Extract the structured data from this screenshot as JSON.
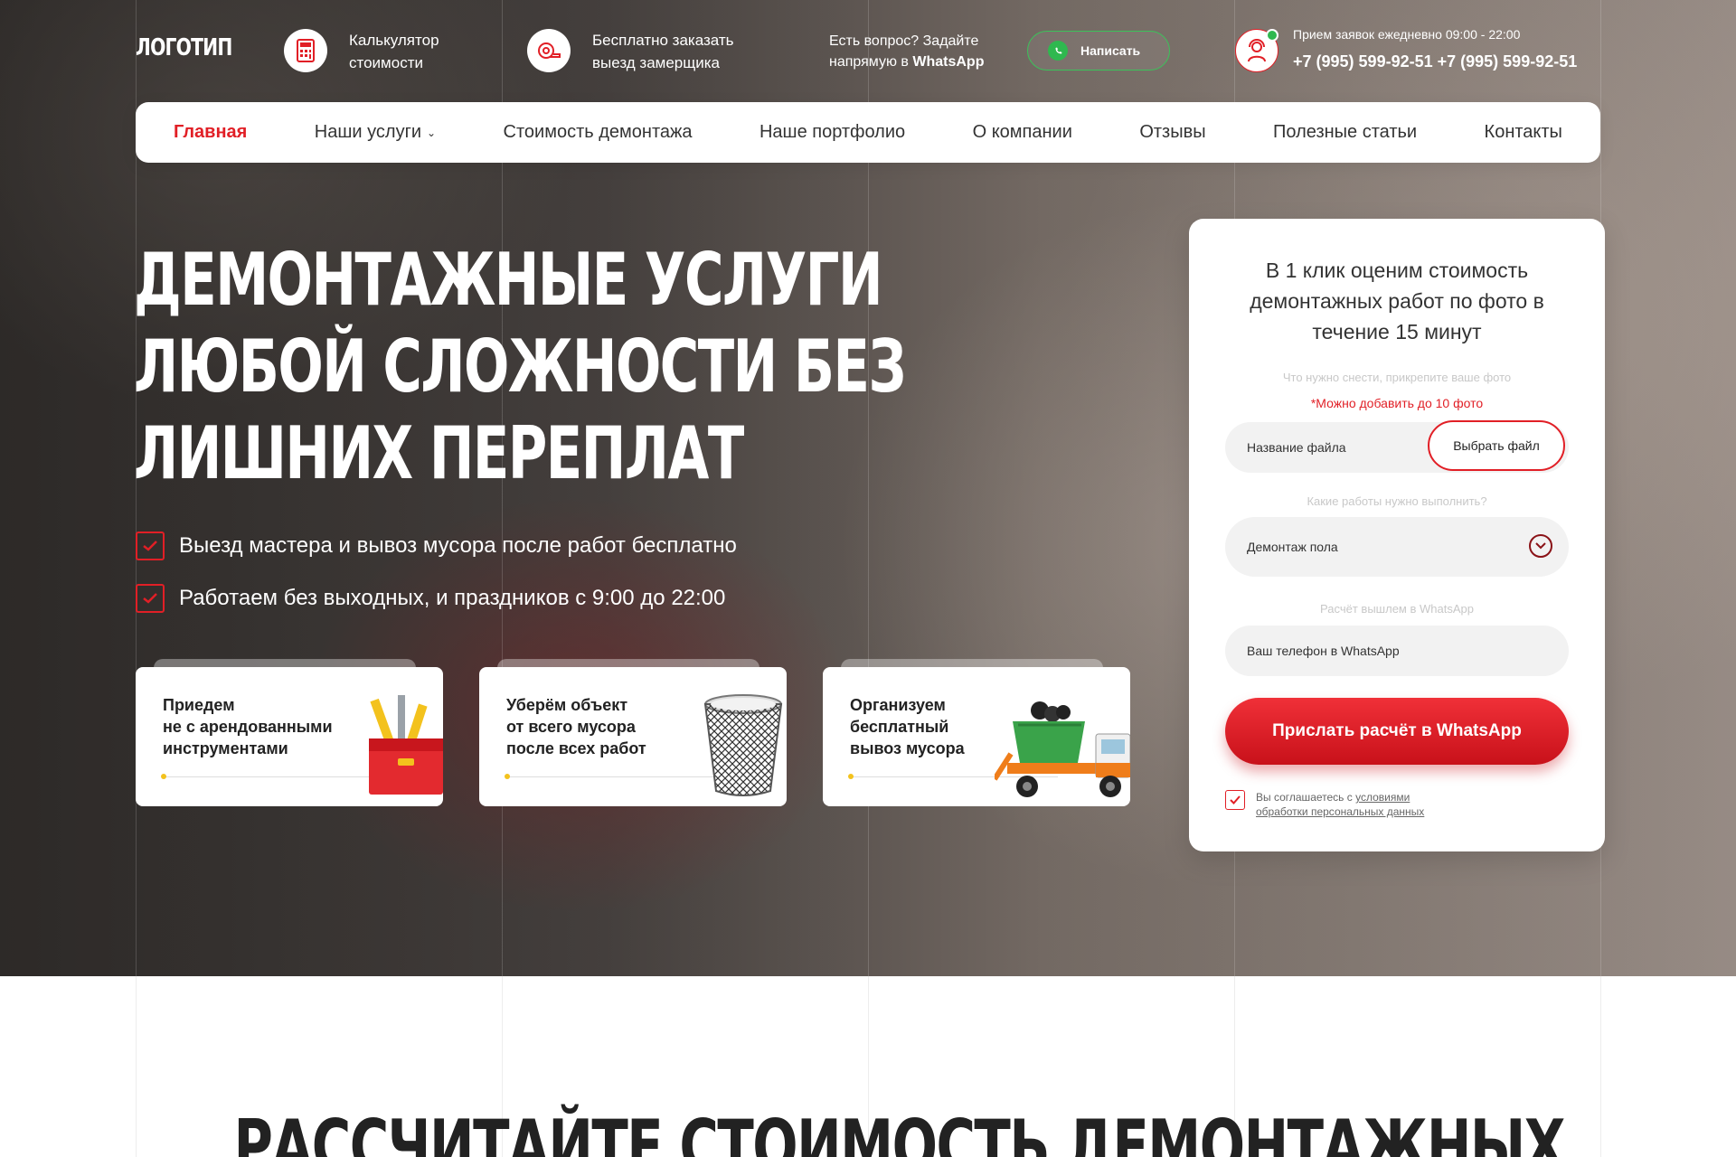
{
  "header": {
    "logo": "ЛОГОТИП",
    "calculator_line1": "Калькулятор",
    "calculator_line2": "стоимости",
    "measure_line1": "Бесплатно заказать",
    "measure_line2": "выезд замерщика",
    "question_line1": "Есть вопрос? Задайте",
    "question_line2_prefix": "напрямую в ",
    "question_line2_bold": "WhatsApp",
    "whatsapp_button": "Написать",
    "schedule": "Прием заявок ежедневно 09:00 - 22:00",
    "phone1": "+7 (995) 599-92-51",
    "phone2": "+7 (995) 599-92-51"
  },
  "nav": {
    "items": [
      "Главная",
      "Наши услуги",
      "Стоимость демонтажа",
      "Наше портфолио",
      "О компании",
      "Отзывы",
      "Полезные статьи",
      "Контакты"
    ]
  },
  "hero": {
    "title_line1": "Демонтажные услуги",
    "title_line2": "любой сложности без",
    "title_line3": "лишних переплат",
    "feature1": "Выезд мастера и вывоз мусора после работ бесплатно",
    "feature2": "Работаем без выходных, и праздников с 9:00 до 22:00",
    "cards": [
      {
        "line1": "Приедем",
        "line2": "не с арендованными",
        "line3": "инструментами",
        "icon": "toolbox-icon"
      },
      {
        "line1": "Уберём объект",
        "line2": "от всего мусора",
        "line3": "после всех работ",
        "icon": "trash-bin-icon"
      },
      {
        "line1": "Организуем",
        "line2": "бесплатный",
        "line3": "вывоз мусора",
        "icon": "garbage-truck-icon"
      }
    ]
  },
  "form": {
    "title": "В 1 клик оценим стоимость демонтажных работ по фото в течение 15 минут",
    "photo_label": "Что нужно снести, прикрепите ваше фото",
    "photo_note": "*Можно добавить до 10 фото",
    "file_placeholder": "Название файла",
    "file_button": "Выбрать файл",
    "works_label": "Какие работы нужно выполнить?",
    "works_value": "Демонтаж пола",
    "phone_label": "Расчёт вышлем в WhatsApp",
    "phone_placeholder": "Ваш телефон в WhatsApp",
    "submit": "Прислать расчёт в WhatsApp",
    "agree_prefix": "Вы соглашаетесь с ",
    "agree_link": "условиями обработки персональных данных"
  },
  "section": {
    "title": "Рассчитайте стоимость демонтажных"
  },
  "colors": {
    "accent": "#e11f26",
    "whatsapp": "#2fb84f"
  }
}
